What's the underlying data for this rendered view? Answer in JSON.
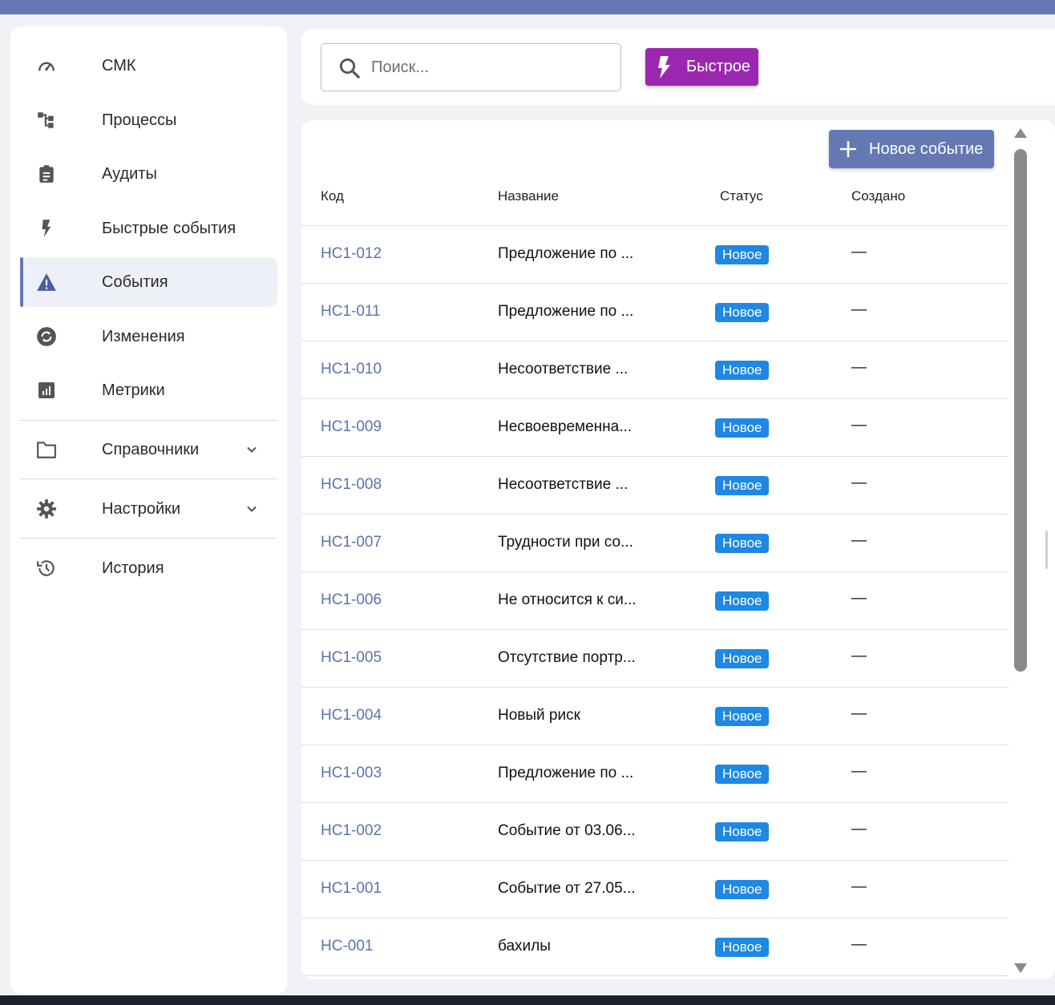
{
  "sidebar": {
    "items": [
      {
        "label": "СМК",
        "icon": "speedometer-icon"
      },
      {
        "label": "Процессы",
        "icon": "process-tree-icon"
      },
      {
        "label": "Аудиты",
        "icon": "clipboard-icon"
      },
      {
        "label": "Быстрые события",
        "icon": "lightning-icon"
      },
      {
        "label": "События",
        "icon": "warning-triangle-icon",
        "active": true
      },
      {
        "label": "Изменения",
        "icon": "sync-icon"
      },
      {
        "label": "Метрики",
        "icon": "bar-chart-icon"
      },
      {
        "label": "Справочники",
        "icon": "folder-icon",
        "expandable": true
      },
      {
        "label": "Настройки",
        "icon": "gear-icon",
        "expandable": true
      },
      {
        "label": "История",
        "icon": "history-icon"
      }
    ]
  },
  "search": {
    "placeholder": "Поиск...",
    "value": ""
  },
  "quick_button": {
    "label": "Быстрое"
  },
  "new_event_button": {
    "label": "Новое событие"
  },
  "table": {
    "headers": {
      "code": "Код",
      "name": "Название",
      "status": "Статус",
      "created": "Создано"
    },
    "rows": [
      {
        "code": "НС1-012",
        "name": "Предложение по ...",
        "status": "Новое",
        "created": "—"
      },
      {
        "code": "НС1-011",
        "name": "Предложение по ...",
        "status": "Новое",
        "created": "—"
      },
      {
        "code": "НС1-010",
        "name": "Несоответствие ...",
        "status": "Новое",
        "created": "—"
      },
      {
        "code": "НС1-009",
        "name": "Несвоевременна...",
        "status": "Новое",
        "created": "—"
      },
      {
        "code": "НС1-008",
        "name": "Несоответствие ...",
        "status": "Новое",
        "created": "—"
      },
      {
        "code": "НС1-007",
        "name": "Трудности при со...",
        "status": "Новое",
        "created": "—"
      },
      {
        "code": "НС1-006",
        "name": "Не относится к си...",
        "status": "Новое",
        "created": "—"
      },
      {
        "code": "НС1-005",
        "name": "Отсутствие портр...",
        "status": "Новое",
        "created": "—"
      },
      {
        "code": "НС1-004",
        "name": "Новый риск",
        "status": "Новое",
        "created": "—"
      },
      {
        "code": "НС1-003",
        "name": "Предложение по ...",
        "status": "Новое",
        "created": "—"
      },
      {
        "code": "НС1-002",
        "name": "Событие от 03.06...",
        "status": "Новое",
        "created": "—"
      },
      {
        "code": "НС1-001",
        "name": "Событие от 27.05...",
        "status": "Новое",
        "created": "—"
      },
      {
        "code": "НС-001",
        "name": "бахилы",
        "status": "Новое",
        "created": "—"
      }
    ]
  },
  "colors": {
    "accent": "#6479b3",
    "quick": "#9b27b0",
    "status_new": "#1e88e5",
    "link": "#5b73ad"
  }
}
